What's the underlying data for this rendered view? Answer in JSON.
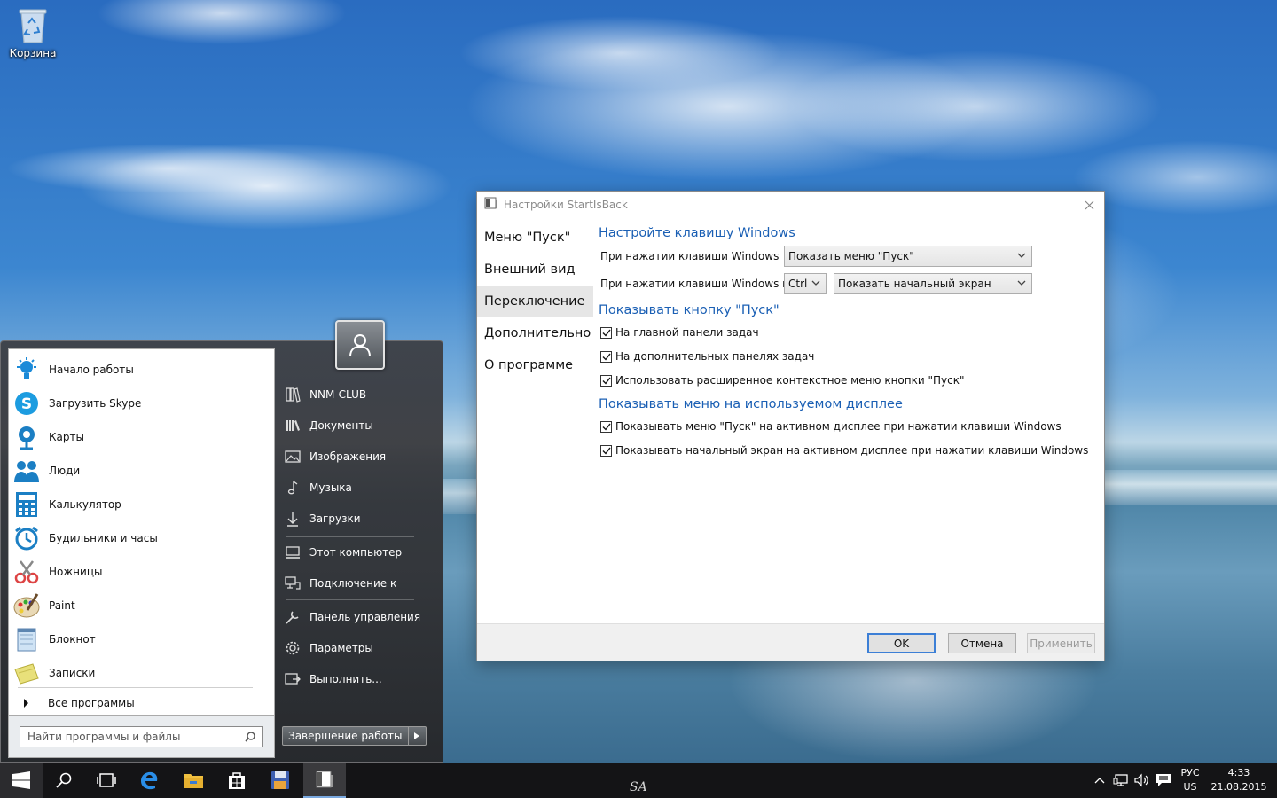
{
  "desktop": {
    "recycle_bin_label": "Корзина"
  },
  "start_menu": {
    "pinned": [
      {
        "label": "Начало работы",
        "icon": "lightbulb-icon"
      },
      {
        "label": "Загрузить Skype",
        "icon": "skype-icon"
      },
      {
        "label": "Карты",
        "icon": "maps-icon"
      },
      {
        "label": "Люди",
        "icon": "people-icon"
      },
      {
        "label": "Калькулятор",
        "icon": "calculator-icon"
      },
      {
        "label": "Будильники и часы",
        "icon": "alarm-clock-icon"
      },
      {
        "label": "Ножницы",
        "icon": "scissors-icon"
      },
      {
        "label": "Paint",
        "icon": "paint-palette-icon"
      },
      {
        "label": "Блокнот",
        "icon": "notepad-icon"
      },
      {
        "label": "Записки",
        "icon": "sticky-notes-icon"
      }
    ],
    "all_programs": "Все программы",
    "search_placeholder": "Найти программы и файлы",
    "right_items": [
      {
        "label": "NNM-CLUB",
        "icon": "user-folder-icon"
      },
      {
        "label": "Документы",
        "icon": "documents-icon"
      },
      {
        "label": "Изображения",
        "icon": "pictures-icon"
      },
      {
        "label": "Музыка",
        "icon": "music-note-icon"
      },
      {
        "label": "Загрузки",
        "icon": "download-arrow-icon"
      },
      {
        "label": "Этот компьютер",
        "icon": "computer-icon"
      },
      {
        "label": "Подключение к",
        "icon": "network-connect-icon"
      },
      {
        "label": "Панель управления",
        "icon": "control-panel-icon"
      },
      {
        "label": "Параметры",
        "icon": "settings-gear-icon"
      },
      {
        "label": "Выполнить...",
        "icon": "run-icon"
      }
    ],
    "shutdown_label": "Завершение работы"
  },
  "dialog": {
    "title": "Настройки StartIsBack",
    "nav": [
      {
        "label": "Меню \"Пуск\"",
        "active": false
      },
      {
        "label": "Внешний вид",
        "active": false
      },
      {
        "label": "Переключение",
        "active": true
      },
      {
        "label": "Дополнительно",
        "active": false
      },
      {
        "label": "О программе",
        "active": false
      }
    ],
    "section1_title": "Настройте клавишу Windows",
    "row1_label": "При нажатии клавиши Windows",
    "row1_value": "Показать меню \"Пуск\"",
    "row2_label": "При нажатии клавиши Windows и",
    "row2_modifier": "Ctrl",
    "row2_value": "Показать начальный экран",
    "section2_title": "Показывать кнопку \"Пуск\"",
    "section2_checks": [
      {
        "label": "На главной панели задач",
        "checked": true
      },
      {
        "label": "На дополнительных панелях задач",
        "checked": true
      },
      {
        "label": "Использовать расширенное контекстное меню кнопки \"Пуск\"",
        "checked": true
      }
    ],
    "section3_title": "Показывать меню на используемом дисплее",
    "section3_checks": [
      {
        "label": "Показывать меню \"Пуск\" на активном дисплее при нажатии клавиши Windows",
        "checked": true
      },
      {
        "label": "Показывать начальный экран на активном дисплее при нажатии клавиши Windows",
        "checked": true
      }
    ],
    "buttons": {
      "ok": "OK",
      "cancel": "Отмена",
      "apply": "Применить"
    }
  },
  "taskbar": {
    "watermark": "SA",
    "apps": [
      "start-windows-icon",
      "search-icon",
      "task-view-icon",
      "edge-icon",
      "file-explorer-icon",
      "store-icon",
      "floppy-save-icon",
      "startisback-icon"
    ],
    "lang_top": "РУС",
    "lang_bottom": "US",
    "time": "4:33",
    "date": "21.08.2015"
  },
  "colors": {
    "accent_blue": "#1a5fb4",
    "taskbar": "#141416",
    "start_menu_dark": "#2e2e30"
  }
}
